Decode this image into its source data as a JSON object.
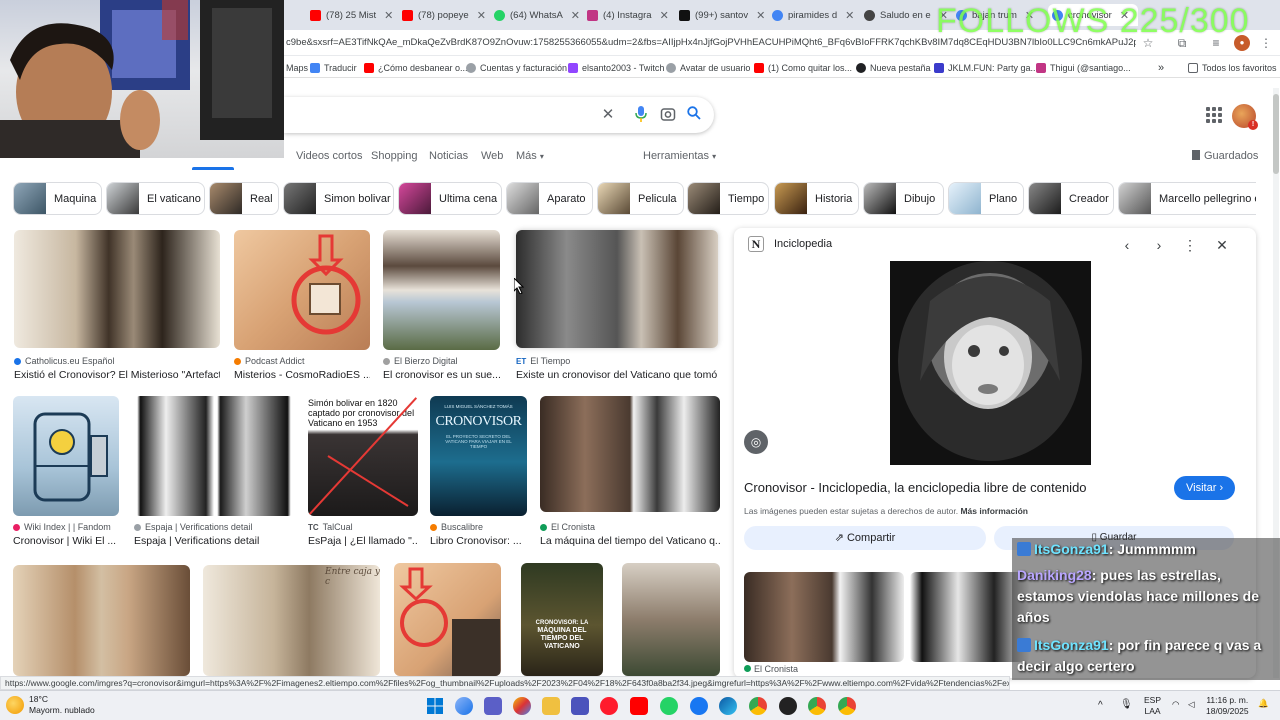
{
  "tabs": [
    {
      "label": "(78) 25 Mist",
      "color": "#ff0000"
    },
    {
      "label": "(78) popeye",
      "color": "#ff0000"
    },
    {
      "label": "(64) WhatsA",
      "color": "#25d366"
    },
    {
      "label": "(4) Instagra",
      "color": "#c13584"
    },
    {
      "label": "(99+) santov",
      "color": "#111111"
    },
    {
      "label": "piramides d",
      "color": "#4285f4"
    },
    {
      "label": "Saludo en e",
      "color": "#444444"
    },
    {
      "label": "bajan trum",
      "color": "#4285f4"
    },
    {
      "label": "cronovisor",
      "color": "#4285f4"
    }
  ],
  "address": {
    "url": "c9be&sxsrf=AE3TifNkQAe_mDkaQeZvBrdK87O9ZnOvuw:1758255366055&udm=2&fbs=AIIjpHx4nJjfGojPVHhEACUHPiMQht6_BFq6vBIoFFRK7qchKBv8IM7dq8CEqHDU3BN7lbIo0LLC9Cn6mkAPuJ2pf_5AevW..."
  },
  "bookmarks": [
    {
      "label": "Maps",
      "color": "#34a853"
    },
    {
      "label": "Traducir",
      "color": "#4285f4"
    },
    {
      "label": "¿Cómo desbanear o...",
      "color": "#ff0000"
    },
    {
      "label": "Cuentas y facturación",
      "color": "#5f6368"
    },
    {
      "label": "elsanto2003 - Twitch",
      "color": "#9146ff"
    },
    {
      "label": "Avatar de usuario",
      "color": "#5f6368"
    },
    {
      "label": "(1) Como quitar los...",
      "color": "#ff0000"
    },
    {
      "label": "Nueva pestaña",
      "color": "#202124"
    },
    {
      "label": "JKLM.FUN: Party ga...",
      "color": "#3b3bcb"
    },
    {
      "label": "Thigui (@santiago...",
      "color": "#c13584"
    },
    {
      "label": "Todos los favoritos",
      "color": "#5f6368"
    }
  ],
  "nav": {
    "videos": "Videos cortos",
    "shopping": "Shopping",
    "news": "Noticias",
    "web": "Web",
    "more": "Más",
    "tools": "Herramientas",
    "saved": "Guardados"
  },
  "chips": [
    "Maquina",
    "El vaticano",
    "Real",
    "Simon bolivar",
    "Ultima cena",
    "Aparato",
    "Pelicula",
    "Tiempo",
    "Historia",
    "Dibujo",
    "Plano",
    "Creador",
    "Marcello pellegrino er"
  ],
  "results_row1": [
    {
      "source": "Catholicus.eu Español",
      "title": "Existió el Cronovisor? El Misterioso \"Artefact...",
      "dot": "#1a73e8"
    },
    {
      "source": "Podcast Addict",
      "title": "Misterios - CosmoRadioES ...",
      "dot": "#f57c00"
    },
    {
      "source": "El Bierzo Digital",
      "title": "El cronovisor es un sue...",
      "dot": "#a0a0a0"
    },
    {
      "source": "El Tiempo",
      "title": "Existe un cronovisor del Vaticano que tomó f...",
      "dot": "#1565c0",
      "prefix": "ET"
    }
  ],
  "results_row2": [
    {
      "source": "Wiki Index | | Fandom",
      "title": "Cronovisor | Wiki El ...",
      "dot": "#e91e63"
    },
    {
      "source": "Espaja | Verifications detail",
      "title": "Espaja | Verifications detail",
      "dot": "#9aa0a6"
    },
    {
      "source": "TalCual",
      "title": "EsPaja | ¿El llamado \"...",
      "dot": "#202124",
      "prefix": "TC"
    },
    {
      "source": "Buscalibre",
      "title": "Libro Cronovisor: ...",
      "dot": "#f57c00"
    },
    {
      "source": "El Cronista",
      "title": "La máquina del tiempo del Vaticano q...",
      "dot": "#0f9d58"
    }
  ],
  "image_text": {
    "bolivar": "Simón bolivar en 1820 captado por cronovisor del Vaticano en 1953",
    "book_author": "LUIS MIGUEL SÁNCHEZ TOMÁS",
    "book_title": "CRONOVISOR",
    "book_sub": "EL PROYECTO SECRETO DEL VATICANO PARA VIAJAR EN EL TIEMPO",
    "handwriting": "Entre caja y c",
    "doc_line1": "CRONOVISOR: LA",
    "doc_line2": "MÁQUINA DEL",
    "doc_line3": "TIEMPO DEL",
    "doc_line4": "VATICANO"
  },
  "panel": {
    "publisher": "Inciclopedia",
    "logo_letter": "N",
    "title": "Cronovisor - Inciclopedia, la enciclopedia libre de contenido",
    "visit": "Visitar",
    "copyright": "Las imágenes pueden estar sujetas a derechos de autor.",
    "more_info": "Más información",
    "share": "Compartir",
    "save": "Guardar",
    "thumb_source": "El Cronista"
  },
  "status_url": "https://www.google.com/imgres?q=cronovisor&imgurl=https%3A%2F%2Fimagenes2.eltiempo.com%2Ffiles%2Fog_thumbnail%2Fuploads%2F2023%2F04%2F18%2F643f0a8ba2f34.jpeg&imgrefurl=https%3A%2F%2Fwww.eltiempo.com%2Fvida%2Ftendencias%2Fexiste-un-cronovisor-del-vaticano-que-tomo-fotos-a-bolivar-y-jesucristo-760471&docid=b...",
  "overlay": {
    "follows": "FOLLOWS 225/300"
  },
  "chat": [
    {
      "user": "ItsGonza91",
      "text": ": Jummmmm",
      "icon": true
    },
    {
      "user": "Daniking28",
      "text": ": pues las estrellas, estamos viendolas hace millones de años",
      "icon": false
    },
    {
      "user": "ItsGonza91",
      "text": ": por fin parece q vas a decir algo certero",
      "icon": true
    }
  ],
  "taskbar": {
    "temp": "18°C",
    "weather": "Mayorm. nublado",
    "lang1": "ESP",
    "lang2": "LAA",
    "time": "11:16 p. m.",
    "date": "18/09/2025"
  }
}
